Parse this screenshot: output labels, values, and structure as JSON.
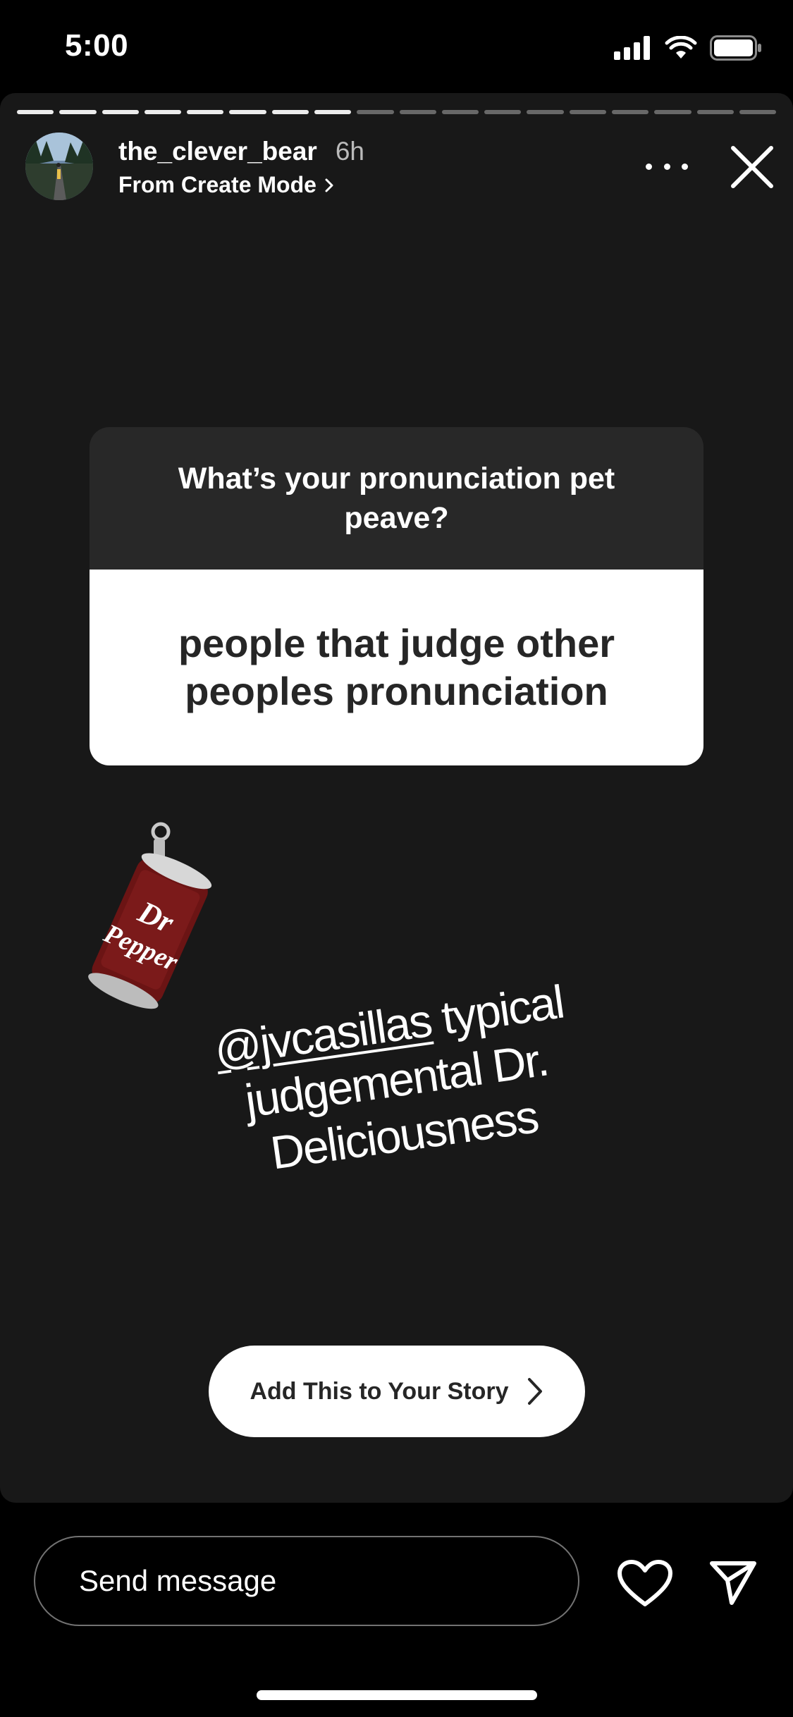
{
  "status_bar": {
    "time": "5:00"
  },
  "story": {
    "progress": {
      "total_segments": 18,
      "completed_segments": 8
    },
    "username": "the_clever_bear",
    "age": "6h",
    "subtitle": "From Create Mode",
    "question": {
      "title": "What’s your pronunciation pet peave?",
      "answer": "people that judge other peoples pronunciation"
    },
    "sticker": "Dr Pepper",
    "caption": {
      "mention": "@jvcasillas",
      "text": "typical judgemental Dr. Deliciousness"
    },
    "add_story_label": "Add This to Your Story"
  },
  "footer": {
    "message_placeholder": "Send message"
  },
  "colors": {
    "story_background": "#181818",
    "card_header": "#282828",
    "card_body": "#ffffff"
  },
  "icons": [
    "signal-icon",
    "wifi-icon",
    "battery-icon",
    "more-icon",
    "close-icon",
    "chevron-right-icon",
    "heart-icon",
    "send-icon"
  ]
}
